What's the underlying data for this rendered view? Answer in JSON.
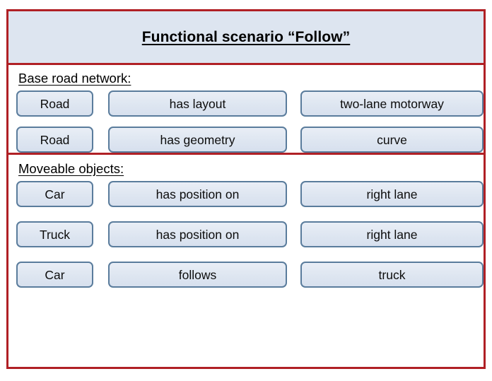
{
  "colors": {
    "frame_red": "#B02025",
    "header_fill": "#DDE5F0",
    "node_fill": "#DEE6F1",
    "node_border": "#5A7C9C",
    "text": "#000000"
  },
  "header": {
    "title": "Functional scenario “Follow”"
  },
  "sections": [
    {
      "label": "Base road network:",
      "rows": [
        {
          "subject": "Road",
          "predicate": "has layout",
          "object": "two-lane motorway"
        },
        {
          "subject": "Road",
          "predicate": "has geometry",
          "object": "curve"
        }
      ]
    },
    {
      "label": "Moveable objects:",
      "rows": [
        {
          "subject": "Car",
          "predicate": "has position on",
          "object": "right lane"
        },
        {
          "subject": "Truck",
          "predicate": "has position on",
          "object": "right lane"
        },
        {
          "subject": "Car",
          "predicate": "follows",
          "object": "truck"
        }
      ]
    }
  ]
}
